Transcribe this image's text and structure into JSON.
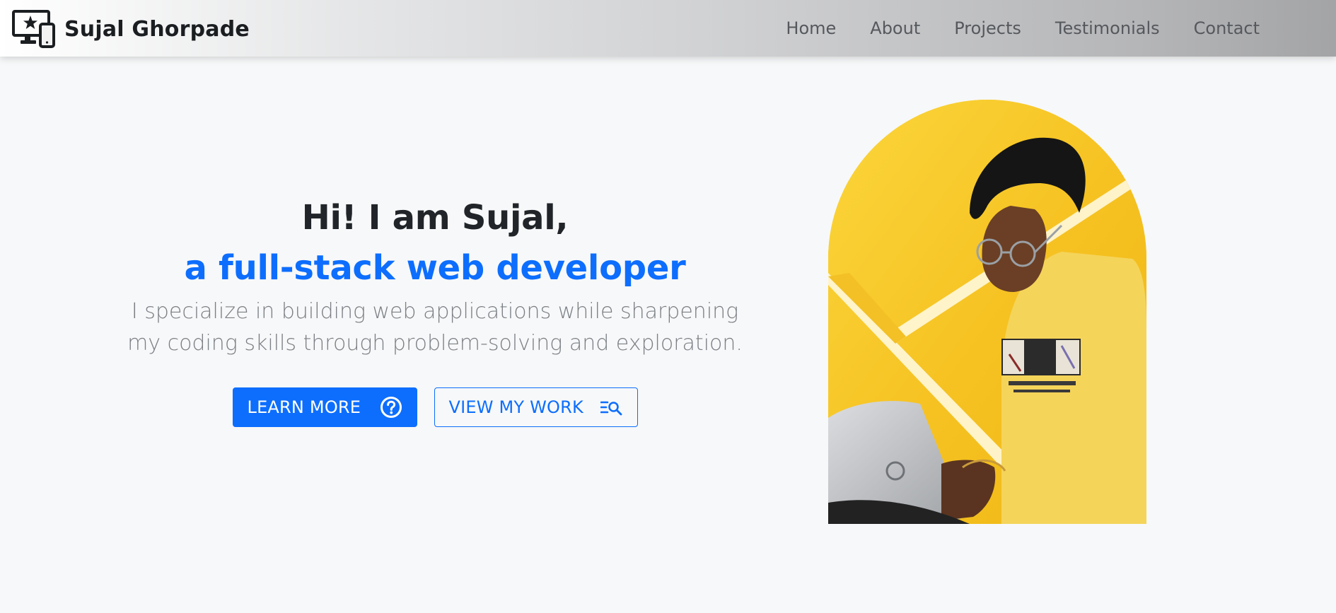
{
  "navbar": {
    "brand_name": "Sujal Ghorpade",
    "brand_icon": "devices-star-icon",
    "links": [
      {
        "label": "Home"
      },
      {
        "label": "About"
      },
      {
        "label": "Projects"
      },
      {
        "label": "Testimonials"
      },
      {
        "label": "Contact"
      }
    ]
  },
  "hero": {
    "greeting": "Hi! I am Sujal,",
    "role": "a full-stack web developer",
    "description": "I specialize in building web applications while sharpening my coding skills through problem-solving and exploration.",
    "primary_button": {
      "label": "LEARN MORE",
      "icon": "question-circle-icon"
    },
    "secondary_button": {
      "label": "VIEW MY WORK",
      "icon": "list-search-icon"
    },
    "photo": {
      "alt": "Portrait of Sujal"
    }
  },
  "colors": {
    "accent": "#0d6efd",
    "heading": "#212529",
    "body_text": "#7b7f84",
    "background": "#f7f8f9",
    "photo_background": "#f7c72a"
  }
}
